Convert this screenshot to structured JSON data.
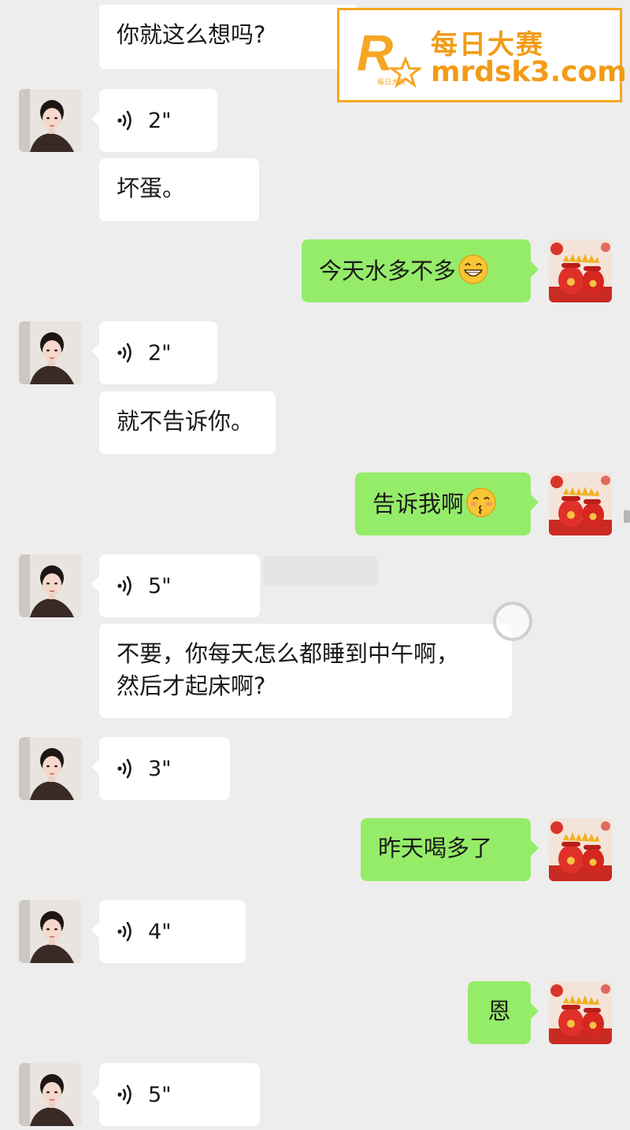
{
  "watermark": {
    "logo_letter": "R",
    "logo_small": "每日大赛",
    "title": "每日大赛",
    "url": "mrdsk3.com"
  },
  "messages": [
    {
      "side": "in",
      "type": "text",
      "text": "你就这么想吗?"
    },
    {
      "side": "in",
      "type": "voice",
      "duration": "2\""
    },
    {
      "side": "in",
      "type": "text",
      "text": "坏蛋。"
    },
    {
      "side": "out",
      "type": "text",
      "text": "今天水多不多",
      "emoji": "grin-emoji"
    },
    {
      "side": "in",
      "type": "voice",
      "duration": "2\""
    },
    {
      "side": "in",
      "type": "text",
      "text": "就不告诉你。"
    },
    {
      "side": "out",
      "type": "text",
      "text": "告诉我啊",
      "emoji": "kiss-emoji"
    },
    {
      "side": "in",
      "type": "voice",
      "duration": "5\""
    },
    {
      "side": "in",
      "type": "text",
      "text": "不要，你每天怎么都睡到中午啊，",
      "text2": "然后才起床啊?"
    },
    {
      "side": "in",
      "type": "voice",
      "duration": "3\""
    },
    {
      "side": "out",
      "type": "text",
      "text": "昨天喝多了"
    },
    {
      "side": "in",
      "type": "voice",
      "duration": "4\""
    },
    {
      "side": "out",
      "type": "text",
      "text": "恩"
    },
    {
      "side": "in",
      "type": "voice",
      "duration": "5\""
    }
  ],
  "colors": {
    "background": "#ededed",
    "incoming": "#ffffff",
    "outgoing": "#95ec69",
    "watermark": "#f29b16"
  }
}
